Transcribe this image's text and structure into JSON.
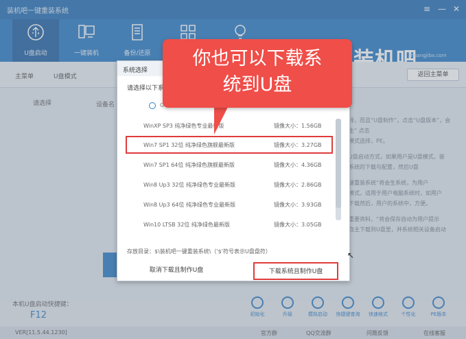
{
  "window": {
    "title": "装机吧一键重装系统",
    "menu_icon": "≡",
    "min_icon": "—",
    "close_icon": "✕"
  },
  "nav": [
    {
      "label": "U盘启动",
      "icon": "usb-icon"
    },
    {
      "label": "一键装机",
      "icon": "computer-icon"
    },
    {
      "label": "备份/还原",
      "icon": "document-icon"
    },
    {
      "label": "",
      "icon": "grid-icon"
    },
    {
      "label": "",
      "icon": "bulb-icon"
    }
  ],
  "brand": {
    "name": "装机吧",
    "url": "zhuangjiba.com"
  },
  "breadcrumb": [
    "主菜单",
    "U盘模式"
  ],
  "back_button": "返回主菜单",
  "bg_labels": {
    "select": "请选择",
    "device": "设备名"
  },
  "right_text": [
    "择，而且“U盘制作”，点击“U盘版本”，会生“ 点击",
    "模式选择，PE。",
    "U盘启动方式，如果用户是U盘模式，装",
    "系统的下载与配置，然后U盘",
    "键重装系统“将会生系统，为用户",
    "模式，适用于用户电脑系统时，如用户",
    "下载然后，用户的系统中，方便。",
    "重要资料，“将会保存自动为用户提示",
    "自主下载到U盘里，并系统相关设备启动"
  ],
  "dialog": {
    "title": "系统选择",
    "subtitle": "请选择以下系统",
    "radio_label": "G",
    "size_prefix": "镜像大小：",
    "items": [
      {
        "name": "WinXP SP3 纯净绿色专业最新版",
        "size": "1.56GB",
        "selected": false
      },
      {
        "name": "Win7 SP1 32位 纯净绿色旗舰最新版",
        "size": "3.27GB",
        "selected": true
      },
      {
        "name": "Win7 SP1 64位 纯净绿色旗舰最新版",
        "size": "4.36GB",
        "selected": false
      },
      {
        "name": "Win8 Up3 32位 纯净绿色专业最新版",
        "size": "2.86GB",
        "selected": false
      },
      {
        "name": "Win8 Up3 64位 纯净绿色专业最新版",
        "size": "3.93GB",
        "selected": false
      },
      {
        "name": "Win10 LTSB 32位 纯净绿色最新版",
        "size": "3.05GB",
        "selected": false
      }
    ],
    "path": "存放目录：$\\装机吧一键重装系统\\（'$'符号表示U盘盘符）",
    "cancel": "取消下载且制作U盘",
    "confirm": "下载系统且制作U盘"
  },
  "callout": {
    "line1": "你也可以下载系",
    "line2": "统到U盘"
  },
  "hotkey": {
    "label": "本机U盘启动快捷键：",
    "key": "F12"
  },
  "bottom_icons": [
    "初始化",
    "升级",
    "模拟启动",
    "快捷键查询",
    "快速格式",
    "个性化",
    "PE版本"
  ],
  "footer": {
    "version": "VER[11.5.44.1230]",
    "group": "官方群",
    "qq": "QQ交流群",
    "feedback": "问题反馈",
    "service": "在线客服"
  }
}
